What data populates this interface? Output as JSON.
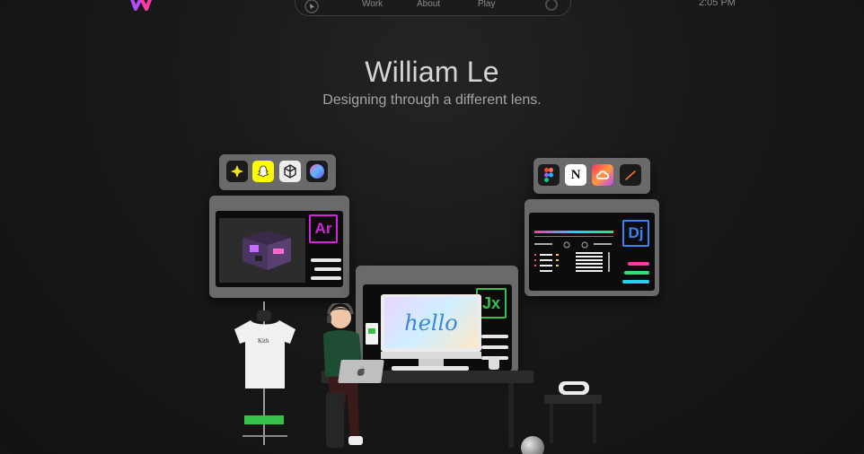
{
  "header": {
    "logo": "wl-logo-icon",
    "nav": {
      "cursor_icon": "cursor-icon",
      "links": [
        "Work",
        "About",
        "Play"
      ],
      "theme_toggle_icon": "theme-toggle-icon"
    },
    "clock": "2:05 PM"
  },
  "hero": {
    "title": "William Le",
    "subtitle": "Designing through a different lens."
  },
  "scene": {
    "left_app_icons": [
      "sparkle-icon",
      "snapchat-icon",
      "unity-icon",
      "iridescent-sphere-icon"
    ],
    "right_app_icons": [
      "figma-icon",
      "notion-icon",
      "creative-cloud-icon",
      "procreate-icon"
    ],
    "left_badge": "Ar",
    "right_badge": "Dj",
    "center_badge": "Jx",
    "monitor_text": "hello",
    "shirt_text": "Kith",
    "accent_colors": {
      "ar": "#d426d8",
      "dj": "#3b82f6",
      "jx": "#36c24a",
      "pink": "#ff3aa3",
      "green": "#2fe07a",
      "cyan": "#22d3ee"
    }
  }
}
